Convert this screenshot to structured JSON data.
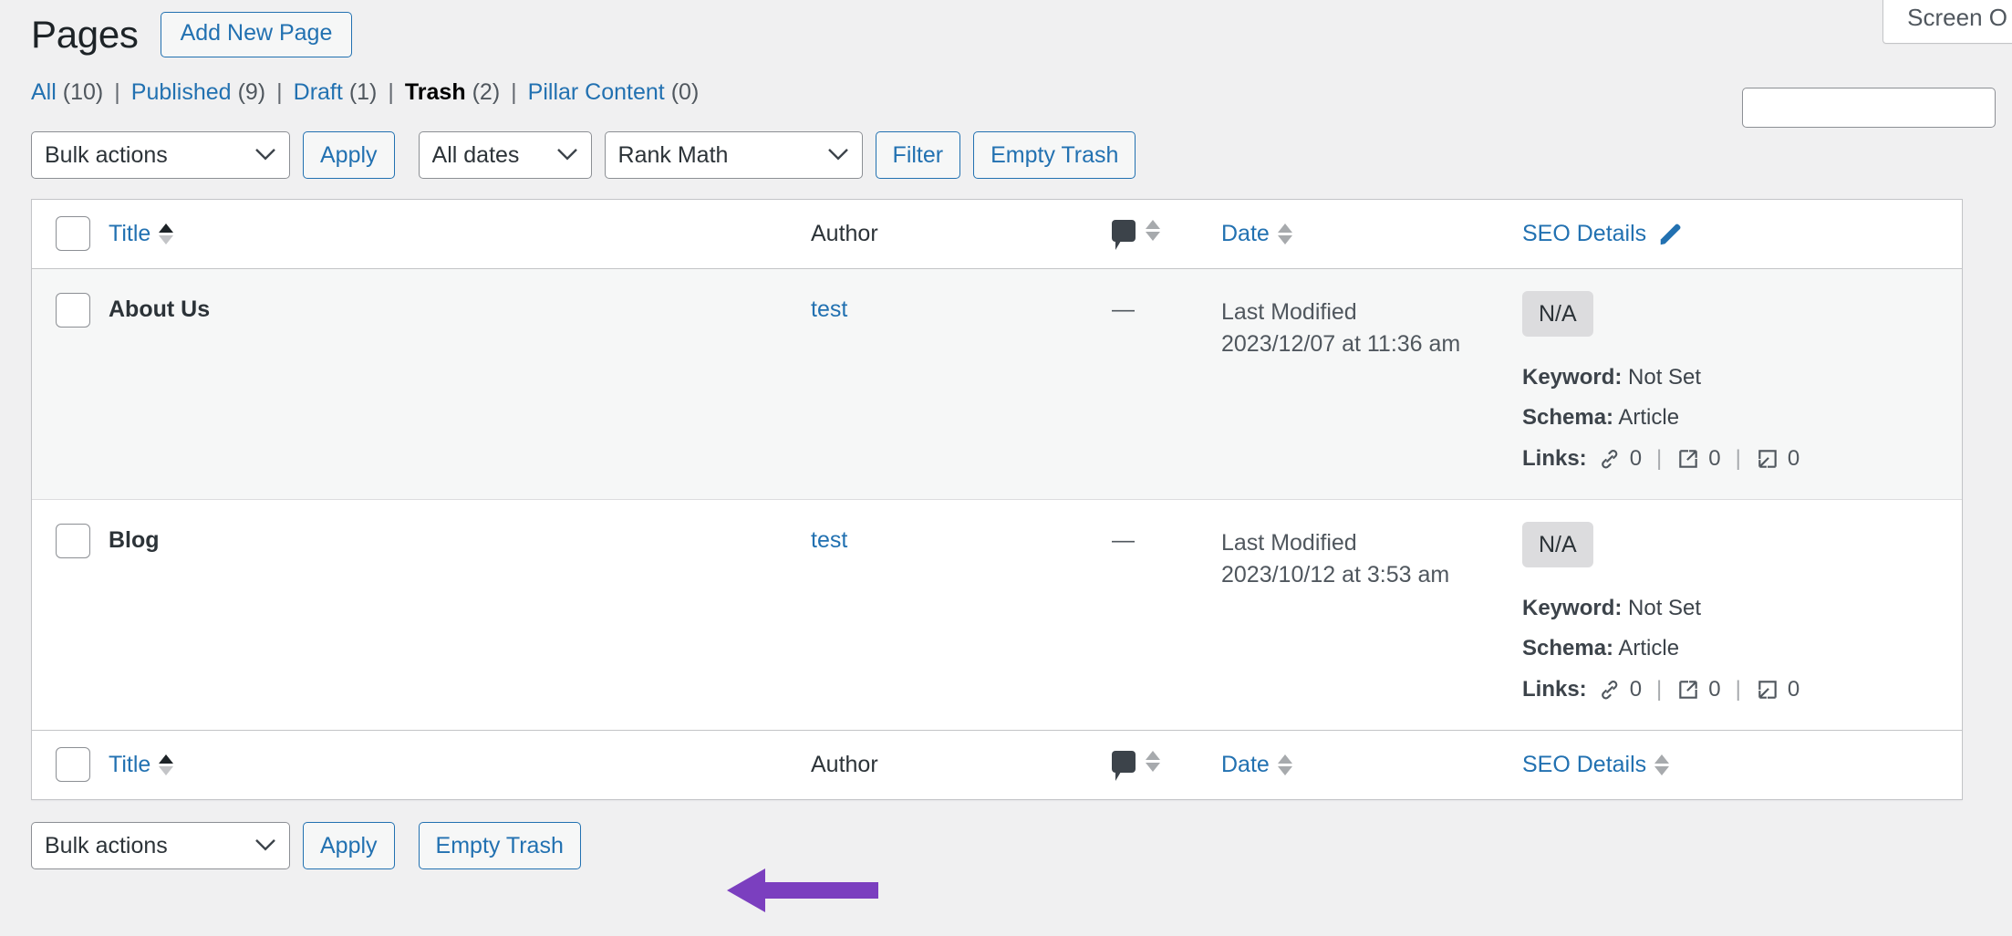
{
  "screen_meta": {
    "screen_options_label": "Screen O"
  },
  "header": {
    "title": "Pages",
    "add_new_label": "Add New Page"
  },
  "search": {
    "value": "",
    "placeholder": ""
  },
  "filters": [
    {
      "label": "All",
      "count": "(10)",
      "current": false
    },
    {
      "label": "Published",
      "count": "(9)",
      "current": false
    },
    {
      "label": "Draft",
      "count": "(1)",
      "current": false
    },
    {
      "label": "Trash",
      "count": "(2)",
      "current": true
    },
    {
      "label": "Pillar Content",
      "count": "(0)",
      "current": false
    }
  ],
  "separator": "|",
  "toolbar_top": {
    "bulk_actions_value": "Bulk actions",
    "apply_label": "Apply",
    "dates_value": "All dates",
    "rankmath_value": "Rank Math",
    "filter_label": "Filter",
    "empty_trash_label": "Empty Trash"
  },
  "toolbar_bottom": {
    "bulk_actions_value": "Bulk actions",
    "apply_label": "Apply",
    "empty_trash_label": "Empty Trash"
  },
  "table": {
    "columns": {
      "title": "Title",
      "author": "Author",
      "comments_icon": "comment-bubble-icon",
      "date": "Date",
      "seo_details": "SEO Details"
    },
    "rows": [
      {
        "title": "About Us",
        "author": "test",
        "comments": "—",
        "date_label": "Last Modified",
        "date_value": "2023/12/07 at 11:36 am",
        "seo_score": "N/A",
        "keyword_label": "Keyword:",
        "keyword_value": "Not Set",
        "schema_label": "Schema:",
        "schema_value": "Article",
        "links_label": "Links:",
        "links_internal": "0",
        "links_external": "0",
        "links_incoming": "0",
        "striped": true
      },
      {
        "title": "Blog",
        "author": "test",
        "comments": "—",
        "date_label": "Last Modified",
        "date_value": "2023/10/12 at 3:53 am",
        "seo_score": "N/A",
        "keyword_label": "Keyword:",
        "keyword_value": "Not Set",
        "schema_label": "Schema:",
        "schema_value": "Article",
        "links_label": "Links:",
        "links_internal": "0",
        "links_external": "0",
        "links_incoming": "0",
        "striped": false
      }
    ]
  },
  "colors": {
    "link": "#2271b1",
    "text": "#3c434a",
    "page_bg": "#f0f0f1",
    "row_stripe": "#f6f7f7",
    "badge_bg": "#dcdcde",
    "annotation_purple": "#7b3fbf"
  },
  "annotation": {
    "shape": "left-pointing-arrow",
    "target": "Empty Trash"
  }
}
